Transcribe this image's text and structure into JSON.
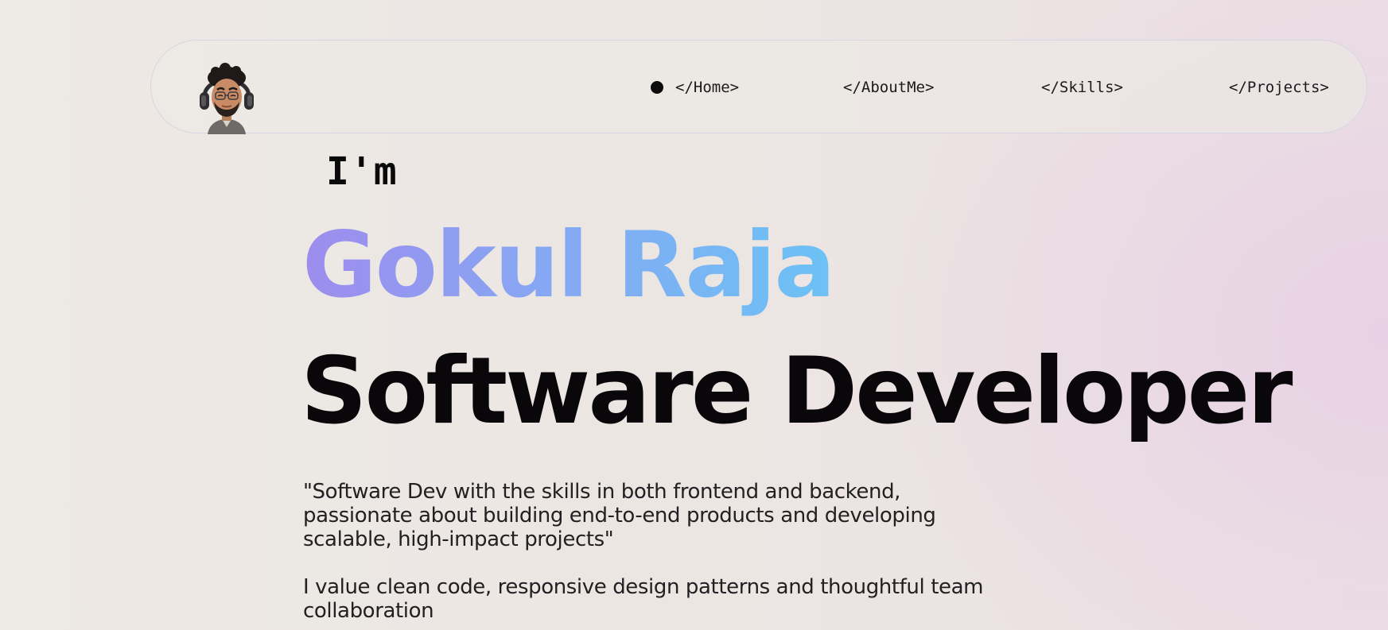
{
  "nav": {
    "items": [
      {
        "label": "</Home>",
        "active": true
      },
      {
        "label": "</AboutMe>",
        "active": false
      },
      {
        "label": "</Skills>",
        "active": false
      },
      {
        "label": "</Projects>",
        "active": false
      }
    ],
    "avatar_icon": "avatar-memoji-icon",
    "active_indicator_icon": "dot-icon"
  },
  "hero": {
    "intro": "I'm",
    "name": "Gokul Raja",
    "role": "Software Developer",
    "quote": "\"Software Dev with the skills in both frontend and backend, passionate about building end-to-end products and developing scalable, high-impact projects\"",
    "values": "I value clean code, responsive design patterns and thoughtful team collaboration"
  },
  "colors": {
    "name_gradient_start": "#9e8ced",
    "name_gradient_end": "#6cc2f4",
    "text_dark": "#0a070b",
    "background": "#ece6e3",
    "background_accent": "#e8d4e3"
  }
}
